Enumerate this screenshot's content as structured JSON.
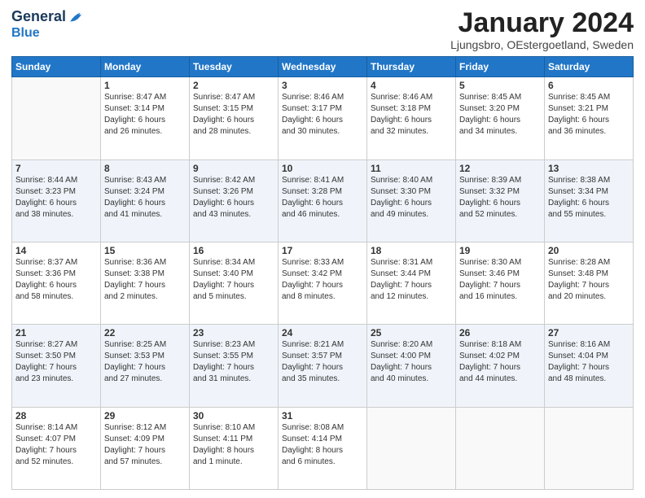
{
  "header": {
    "logo_line1": "General",
    "logo_line2": "Blue",
    "month": "January 2024",
    "location": "Ljungsbro, OEstergoetland, Sweden"
  },
  "days_of_week": [
    "Sunday",
    "Monday",
    "Tuesday",
    "Wednesday",
    "Thursday",
    "Friday",
    "Saturday"
  ],
  "weeks": [
    [
      {
        "day": "",
        "info": ""
      },
      {
        "day": "1",
        "info": "Sunrise: 8:47 AM\nSunset: 3:14 PM\nDaylight: 6 hours\nand 26 minutes."
      },
      {
        "day": "2",
        "info": "Sunrise: 8:47 AM\nSunset: 3:15 PM\nDaylight: 6 hours\nand 28 minutes."
      },
      {
        "day": "3",
        "info": "Sunrise: 8:46 AM\nSunset: 3:17 PM\nDaylight: 6 hours\nand 30 minutes."
      },
      {
        "day": "4",
        "info": "Sunrise: 8:46 AM\nSunset: 3:18 PM\nDaylight: 6 hours\nand 32 minutes."
      },
      {
        "day": "5",
        "info": "Sunrise: 8:45 AM\nSunset: 3:20 PM\nDaylight: 6 hours\nand 34 minutes."
      },
      {
        "day": "6",
        "info": "Sunrise: 8:45 AM\nSunset: 3:21 PM\nDaylight: 6 hours\nand 36 minutes."
      }
    ],
    [
      {
        "day": "7",
        "info": "Sunrise: 8:44 AM\nSunset: 3:23 PM\nDaylight: 6 hours\nand 38 minutes."
      },
      {
        "day": "8",
        "info": "Sunrise: 8:43 AM\nSunset: 3:24 PM\nDaylight: 6 hours\nand 41 minutes."
      },
      {
        "day": "9",
        "info": "Sunrise: 8:42 AM\nSunset: 3:26 PM\nDaylight: 6 hours\nand 43 minutes."
      },
      {
        "day": "10",
        "info": "Sunrise: 8:41 AM\nSunset: 3:28 PM\nDaylight: 6 hours\nand 46 minutes."
      },
      {
        "day": "11",
        "info": "Sunrise: 8:40 AM\nSunset: 3:30 PM\nDaylight: 6 hours\nand 49 minutes."
      },
      {
        "day": "12",
        "info": "Sunrise: 8:39 AM\nSunset: 3:32 PM\nDaylight: 6 hours\nand 52 minutes."
      },
      {
        "day": "13",
        "info": "Sunrise: 8:38 AM\nSunset: 3:34 PM\nDaylight: 6 hours\nand 55 minutes."
      }
    ],
    [
      {
        "day": "14",
        "info": "Sunrise: 8:37 AM\nSunset: 3:36 PM\nDaylight: 6 hours\nand 58 minutes."
      },
      {
        "day": "15",
        "info": "Sunrise: 8:36 AM\nSunset: 3:38 PM\nDaylight: 7 hours\nand 2 minutes."
      },
      {
        "day": "16",
        "info": "Sunrise: 8:34 AM\nSunset: 3:40 PM\nDaylight: 7 hours\nand 5 minutes."
      },
      {
        "day": "17",
        "info": "Sunrise: 8:33 AM\nSunset: 3:42 PM\nDaylight: 7 hours\nand 8 minutes."
      },
      {
        "day": "18",
        "info": "Sunrise: 8:31 AM\nSunset: 3:44 PM\nDaylight: 7 hours\nand 12 minutes."
      },
      {
        "day": "19",
        "info": "Sunrise: 8:30 AM\nSunset: 3:46 PM\nDaylight: 7 hours\nand 16 minutes."
      },
      {
        "day": "20",
        "info": "Sunrise: 8:28 AM\nSunset: 3:48 PM\nDaylight: 7 hours\nand 20 minutes."
      }
    ],
    [
      {
        "day": "21",
        "info": "Sunrise: 8:27 AM\nSunset: 3:50 PM\nDaylight: 7 hours\nand 23 minutes."
      },
      {
        "day": "22",
        "info": "Sunrise: 8:25 AM\nSunset: 3:53 PM\nDaylight: 7 hours\nand 27 minutes."
      },
      {
        "day": "23",
        "info": "Sunrise: 8:23 AM\nSunset: 3:55 PM\nDaylight: 7 hours\nand 31 minutes."
      },
      {
        "day": "24",
        "info": "Sunrise: 8:21 AM\nSunset: 3:57 PM\nDaylight: 7 hours\nand 35 minutes."
      },
      {
        "day": "25",
        "info": "Sunrise: 8:20 AM\nSunset: 4:00 PM\nDaylight: 7 hours\nand 40 minutes."
      },
      {
        "day": "26",
        "info": "Sunrise: 8:18 AM\nSunset: 4:02 PM\nDaylight: 7 hours\nand 44 minutes."
      },
      {
        "day": "27",
        "info": "Sunrise: 8:16 AM\nSunset: 4:04 PM\nDaylight: 7 hours\nand 48 minutes."
      }
    ],
    [
      {
        "day": "28",
        "info": "Sunrise: 8:14 AM\nSunset: 4:07 PM\nDaylight: 7 hours\nand 52 minutes."
      },
      {
        "day": "29",
        "info": "Sunrise: 8:12 AM\nSunset: 4:09 PM\nDaylight: 7 hours\nand 57 minutes."
      },
      {
        "day": "30",
        "info": "Sunrise: 8:10 AM\nSunset: 4:11 PM\nDaylight: 8 hours\nand 1 minute."
      },
      {
        "day": "31",
        "info": "Sunrise: 8:08 AM\nSunset: 4:14 PM\nDaylight: 8 hours\nand 6 minutes."
      },
      {
        "day": "",
        "info": ""
      },
      {
        "day": "",
        "info": ""
      },
      {
        "day": "",
        "info": ""
      }
    ]
  ]
}
